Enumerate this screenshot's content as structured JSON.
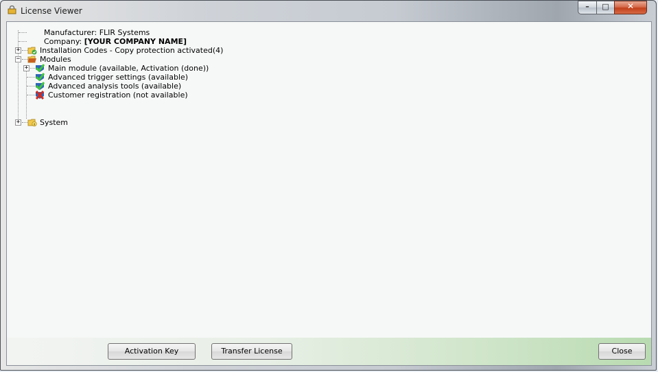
{
  "window": {
    "title": "License Viewer",
    "controls": {
      "minimize": "–",
      "maximize": "□",
      "close": "✕"
    }
  },
  "tree": {
    "manufacturer": "Manufacturer: FLIR Systems",
    "company_prefix": "Company: ",
    "company_value": "[YOUR COMPANY NAME]",
    "installation_codes": "Installation Codes - Copy protection activated(4)",
    "modules": "Modules",
    "module_items": [
      "Main module (available, Activation (done))",
      "Advanced trigger settings (available)",
      "Advanced analysis tools (available)",
      "Customer registration (not available)"
    ],
    "system": "System"
  },
  "buttons": {
    "activation_key": "Activation Key",
    "transfer_license": "Transfer License",
    "close": "Close"
  },
  "colors": {
    "check_green": "#3fa63b",
    "shield_blue": "#2f64b8",
    "error_red": "#d22a1e",
    "folder_yellow": "#f2c94c"
  },
  "icons": {
    "title": "lock-icon",
    "check": "check-shield-icon",
    "error": "error-x-icon",
    "folder": "folder-icon"
  }
}
